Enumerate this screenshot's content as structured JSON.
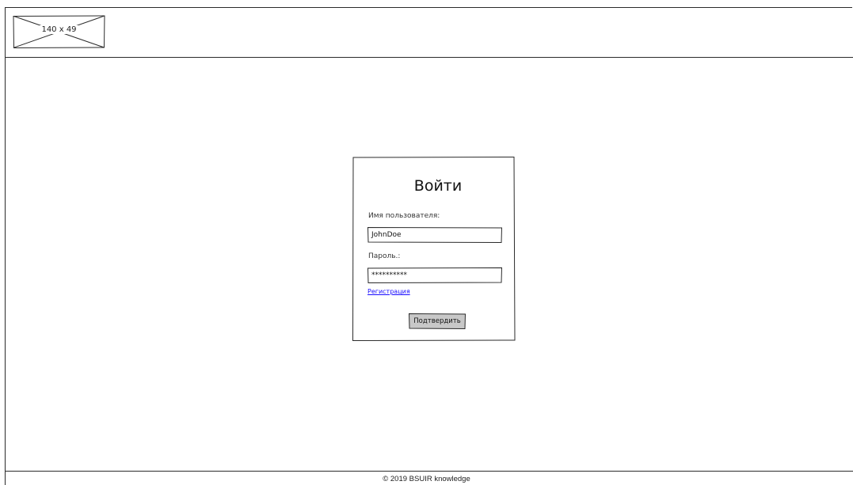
{
  "header": {
    "logo_placeholder_text": "140 x 49"
  },
  "login": {
    "title": "Войти",
    "username_label": "Имя пользователя:",
    "username_value": "JohnDoe",
    "password_label": "Пароль.:",
    "password_value": "**********",
    "register_link": "Регистрация",
    "submit_label": "Подтвердить"
  },
  "footer": {
    "copyright": "© 2019 BSUIR knowledge"
  },
  "colors": {
    "border": "#2b2b2b",
    "link": "#1a0dff",
    "button_fill": "#c8c8c8"
  }
}
